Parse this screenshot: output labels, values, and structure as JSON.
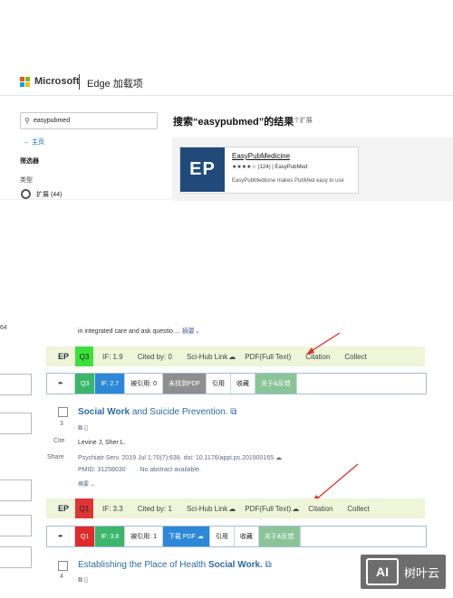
{
  "edge": {
    "brand": "Microsoft",
    "title": "Edge 加载项",
    "search_value": "easypubmed",
    "home": "主页",
    "filters": "筛选器",
    "type_label": "类型",
    "extensions": "扩展 (44)",
    "results_title": "搜索“easypubmed”的结果",
    "results_count": "44 个扩展",
    "card": {
      "logo": "EP",
      "name": "EasyPubMedicine",
      "rating": "★★★★☆ (124) | EasyPubMed",
      "desc": "EasyPubMedicine makes PubMed easy to use"
    }
  },
  "pubmed": {
    "cut_left": "64",
    "snippet": "in integrated care and ask questio ...",
    "more_label": "摘要",
    "bar1": {
      "logo": "EP",
      "quartile": "Q3",
      "if": "IF: 1.9",
      "cited": "Cited by: 0",
      "scihub": "Sci-Hub Link",
      "pdf": "PDF(Full Text)",
      "citation": "Citation",
      "collect": "Collect"
    },
    "bar2": {
      "quartile": "Q3",
      "if": "IF: 2.7",
      "cited": "被引用: 0",
      "pdf": "未找到PDF",
      "cite": "引用",
      "collect": "收藏",
      "about": "关于&反馈"
    },
    "article3": {
      "num": "3",
      "cite": "Cite",
      "share": "Share",
      "title_bold": "Social Work",
      "title_rest": "and Suicide Prevention.",
      "authors": "Levine J, Sher L.",
      "citation": "Psychiatr Serv. 2019 Jul 1;70(7):638. doi: 10.1176/appi.ps.201900165",
      "pmid": "PMID: 31258030",
      "no_abstract": "No abstract available.",
      "abstract_label": "摘要"
    },
    "bar3": {
      "logo": "EP",
      "quartile": "Q1",
      "if": "IF: 3.3",
      "cited": "Cited by: 1",
      "scihub": "Sci-Hub Link",
      "pdf": "PDF(Full Text)",
      "citation": "Citation",
      "collect": "Collect"
    },
    "bar4": {
      "quartile": "Q1",
      "if": "IF: 3.8",
      "cited": "被引用: 1",
      "pdf": "下载 PDF",
      "cite": "引用",
      "collect": "收藏",
      "about": "关于&反馈"
    },
    "article4": {
      "num": "4",
      "title_pre": "Establishing the Place of Health",
      "title_bold": "Social Work."
    }
  },
  "watermark": {
    "logo": "AI",
    "text": "树叶云"
  },
  "colors": {
    "q3": "#3ce03c",
    "q1": "#e03434",
    "link": "#2d6aa0",
    "bar_bg": "#eef5d8"
  }
}
